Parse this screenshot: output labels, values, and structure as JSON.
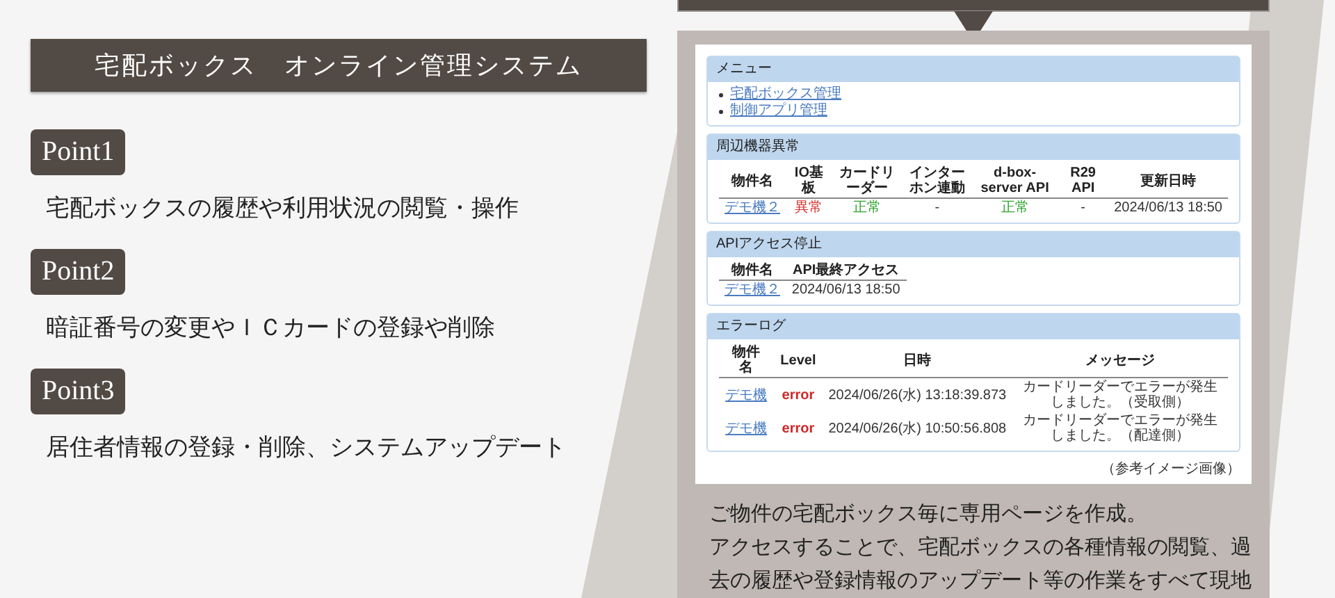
{
  "title": "宅配ボックス　オンライン管理システム",
  "points": [
    {
      "label": "Point1",
      "text": "宅配ボックスの履歴や利用状況の閲覧・操作"
    },
    {
      "label": "Point2",
      "text": "暗証番号の変更やＩＣカードの登録や削除"
    },
    {
      "label": "Point3",
      "text": "居住者情報の登録・削除、システムアップデート"
    }
  ],
  "screenshot": {
    "sections": [
      {
        "kind": "list",
        "title": "メニュー",
        "items": [
          "宅配ボックス管理",
          "制御アプリ管理"
        ]
      },
      {
        "kind": "table",
        "title": "周辺機器異常",
        "columns": [
          "物件名",
          "IO基板",
          "カードリーダー",
          "インターホン連動",
          "d-box-server API",
          "R29 API",
          "更新日時"
        ],
        "rows": [
          [
            {
              "kind": "link",
              "text": "デモ機２"
            },
            {
              "kind": "bad",
              "text": "異常"
            },
            {
              "kind": "ok",
              "text": "正常"
            },
            {
              "kind": "plain",
              "text": "-"
            },
            {
              "kind": "ok",
              "text": "正常"
            },
            {
              "kind": "plain",
              "text": "-"
            },
            {
              "kind": "plain",
              "text": "2024/06/13 18:50"
            }
          ]
        ]
      },
      {
        "kind": "table",
        "title": "APIアクセス停止",
        "columns": [
          "物件名",
          "API最終アクセス"
        ],
        "rows": [
          [
            {
              "kind": "link",
              "text": "デモ機２"
            },
            {
              "kind": "plain",
              "text": "2024/06/13 18:50"
            }
          ]
        ]
      },
      {
        "kind": "table",
        "title": "エラーログ",
        "columns": [
          "物件名",
          "Level",
          "日時",
          "メッセージ"
        ],
        "rows": [
          [
            {
              "kind": "link",
              "text": "デモ機"
            },
            {
              "kind": "error",
              "text": "error"
            },
            {
              "kind": "plain",
              "text": "2024/06/26(水) 13:18:39.873"
            },
            {
              "kind": "message",
              "text": "カードリーダーでエラーが発生しました。（受取側）"
            }
          ],
          [
            {
              "kind": "link",
              "text": "デモ機"
            },
            {
              "kind": "error",
              "text": "error"
            },
            {
              "kind": "plain",
              "text": "2024/06/26(水) 10:50:56.808"
            },
            {
              "kind": "message",
              "text": "カードリーダーでエラーが発生しました。（配達側）"
            }
          ]
        ]
      }
    ],
    "caption": "（参考イメージ画像）"
  },
  "description_lines": [
    "ご物件の宅配ボックス毎に専用ページを作成。",
    "アクセスすることで、宅配ボックスの各種情報の閲覧、過",
    "去の履歴や登録情報のアップデート等の作業をすべて現地"
  ]
}
